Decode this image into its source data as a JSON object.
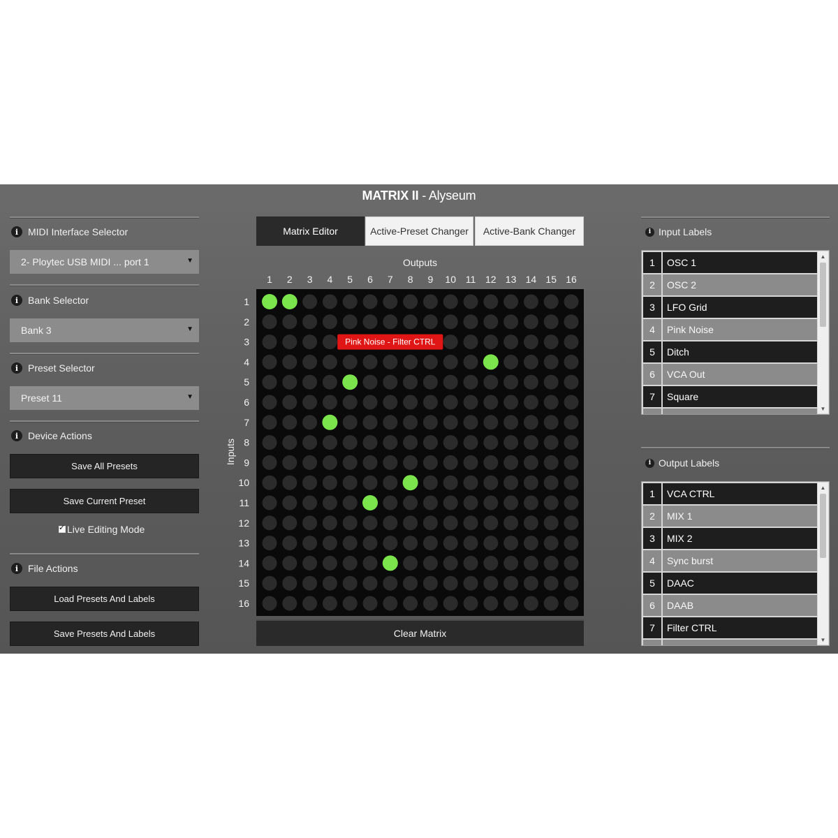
{
  "app": {
    "title_bold": "MATRIX II",
    "title_rest": " - Alyseum"
  },
  "left_panel": {
    "midi": {
      "title": "MIDI Interface Selector",
      "selected": "2- Ploytec USB MIDI ... port 1"
    },
    "bank": {
      "title": "Bank Selector",
      "selected": "Bank 3"
    },
    "preset": {
      "title": "Preset Selector",
      "selected": "Preset 11"
    },
    "device_actions": {
      "title": "Device Actions",
      "save_all": "Save All Presets",
      "save_current": "Save Current Preset",
      "live_editing": "Live Editing Mode",
      "live_editing_checked": true
    },
    "file_actions": {
      "title": "File Actions",
      "load": "Load Presets And Labels",
      "save": "Save Presets And Labels"
    }
  },
  "tabs": [
    {
      "label": "Matrix Editor",
      "active": true
    },
    {
      "label": "Active-Preset Changer",
      "active": false
    },
    {
      "label": "Active-Bank Changer",
      "active": false
    }
  ],
  "matrix": {
    "outputs_label": "Outputs",
    "inputs_label": "Inputs",
    "columns": [
      "1",
      "2",
      "3",
      "4",
      "5",
      "6",
      "7",
      "8",
      "9",
      "10",
      "11",
      "12",
      "13",
      "14",
      "15",
      "16"
    ],
    "rows": [
      "1",
      "2",
      "3",
      "4",
      "5",
      "6",
      "7",
      "8",
      "9",
      "10",
      "11",
      "12",
      "13",
      "14",
      "15",
      "16"
    ],
    "active_cells": [
      {
        "row": 1,
        "col": 1
      },
      {
        "row": 1,
        "col": 2
      },
      {
        "row": 4,
        "col": 12
      },
      {
        "row": 5,
        "col": 5
      },
      {
        "row": 7,
        "col": 4
      },
      {
        "row": 10,
        "col": 8
      },
      {
        "row": 11,
        "col": 6
      },
      {
        "row": 14,
        "col": 7
      }
    ],
    "tooltip": {
      "text": "Pink Noise - Filter CTRL",
      "row": 3,
      "col_start": 5,
      "col_end": 9
    },
    "active_color": "#7be34b",
    "inactive_color": "#2b2b2b",
    "grid_bg": "#0a0a0a",
    "tooltip_color": "#e01616",
    "clear_label": "Clear Matrix"
  },
  "input_labels": {
    "title": "Input Labels",
    "items": [
      {
        "num": "1",
        "label": "OSC 1"
      },
      {
        "num": "2",
        "label": "OSC 2"
      },
      {
        "num": "3",
        "label": "LFO Grid"
      },
      {
        "num": "4",
        "label": "Pink Noise"
      },
      {
        "num": "5",
        "label": "Ditch"
      },
      {
        "num": "6",
        "label": "VCA Out"
      },
      {
        "num": "7",
        "label": "Square"
      }
    ]
  },
  "output_labels": {
    "title": "Output Labels",
    "items": [
      {
        "num": "1",
        "label": "VCA CTRL"
      },
      {
        "num": "2",
        "label": "MIX 1"
      },
      {
        "num": "3",
        "label": "MIX 2"
      },
      {
        "num": "4",
        "label": "Sync burst"
      },
      {
        "num": "5",
        "label": "DAAC"
      },
      {
        "num": "6",
        "label": "DAAB"
      },
      {
        "num": "7",
        "label": "Filter CTRL"
      }
    ]
  }
}
